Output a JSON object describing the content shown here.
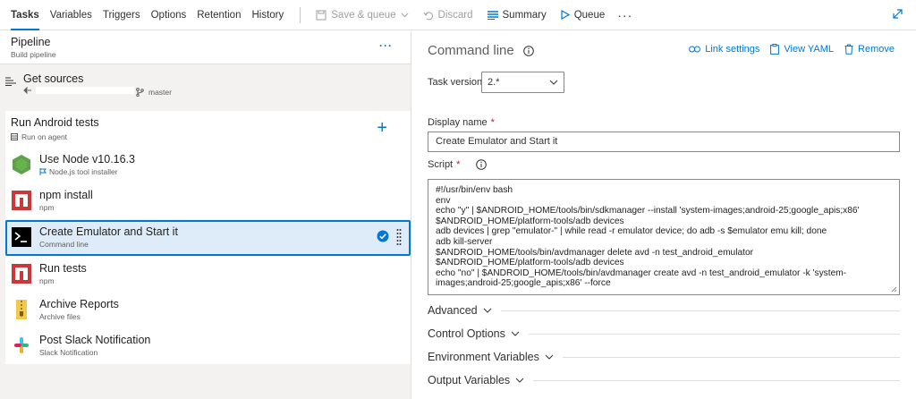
{
  "tabs": [
    "Tasks",
    "Variables",
    "Triggers",
    "Options",
    "Retention",
    "History"
  ],
  "toolbar": {
    "save_queue": "Save & queue",
    "discard": "Discard",
    "summary": "Summary",
    "queue": "Queue"
  },
  "pipeline": {
    "title": "Pipeline",
    "subtitle": "Build pipeline"
  },
  "sources": {
    "title": "Get sources",
    "branch": "master"
  },
  "agent_job": {
    "title": "Run Android tests",
    "subtitle": "Run on agent"
  },
  "tasks": [
    {
      "name": "Use Node v10.16.3",
      "sub": "Node.js tool installer",
      "icon": "nodejs-icon"
    },
    {
      "name": "npm install",
      "sub": "npm",
      "icon": "npm-icon"
    },
    {
      "name": "Create Emulator and Start it",
      "sub": "Command line",
      "icon": "terminal-icon",
      "selected": true
    },
    {
      "name": "Run tests",
      "sub": "npm",
      "icon": "npm-icon"
    },
    {
      "name": "Archive Reports",
      "sub": "Archive files",
      "icon": "archive-icon"
    },
    {
      "name": "Post Slack Notification",
      "sub": "Slack Notification",
      "icon": "slack-icon"
    }
  ],
  "details": {
    "title": "Command line",
    "link_settings": "Link settings",
    "view_yaml": "View YAML",
    "remove": "Remove",
    "task_version_label": "Task version",
    "task_version_value": "2.*",
    "display_name_label": "Display name",
    "display_name_value": "Create Emulator and Start it",
    "script_label": "Script",
    "script_value": "#!/usr/bin/env bash\nenv\necho \"y\" | $ANDROID_HOME/tools/bin/sdkmanager --install 'system-images;android-25;google_apis;x86'\n$ANDROID_HOME/platform-tools/adb devices\nadb devices | grep \"emulator-\" | while read -r emulator device; do adb -s $emulator emu kill; done\nadb kill-server\n$ANDROID_HOME/tools/bin/avdmanager delete avd -n test_android_emulator\n$ANDROID_HOME/platform-tools/adb devices\necho \"no\" | $ANDROID_HOME/tools/bin/avdmanager create avd -n test_android_emulator -k 'system-images;android-25;google_apis;x86' --force",
    "sections": [
      "Advanced",
      "Control Options",
      "Environment Variables",
      "Output Variables"
    ]
  },
  "colors": {
    "accent": "#0078d4",
    "node_green": "#5fa04e",
    "npm_red": "#cb3837"
  }
}
